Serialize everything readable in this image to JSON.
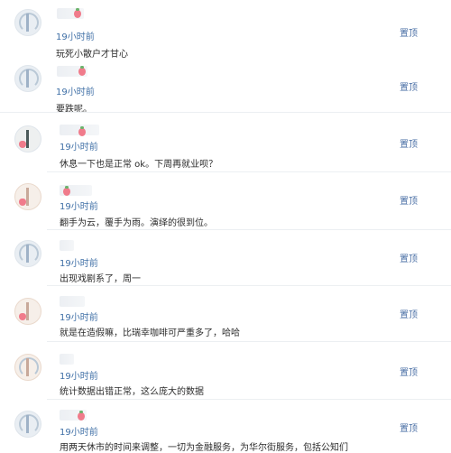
{
  "pin_label": "置顶",
  "comments": [
    {
      "time": "19小时前",
      "text": "玩死小散户才甘心"
    },
    {
      "time": "19小时前",
      "text": "要跌呢。"
    },
    {
      "time": "19小时前",
      "text": "休息一下也是正常 ok。下周再就业呗？"
    },
    {
      "time": "19小时前",
      "text": "翻手为云，覆手为雨。演绎的很到位。"
    },
    {
      "time": "19小时前",
      "text": "出现戏剧系了，周一"
    },
    {
      "time": "19小时前",
      "text": "就是在造假嘛，比瑞幸咖啡可严重多了，哈哈"
    },
    {
      "time": "19小时前",
      "text": "统计数据出错正常，这么庞大的数据"
    },
    {
      "time": "19小时前",
      "text": "用两天休市的时间来调整，一切为金融服务，为华尔街服务，包括公知们"
    }
  ]
}
